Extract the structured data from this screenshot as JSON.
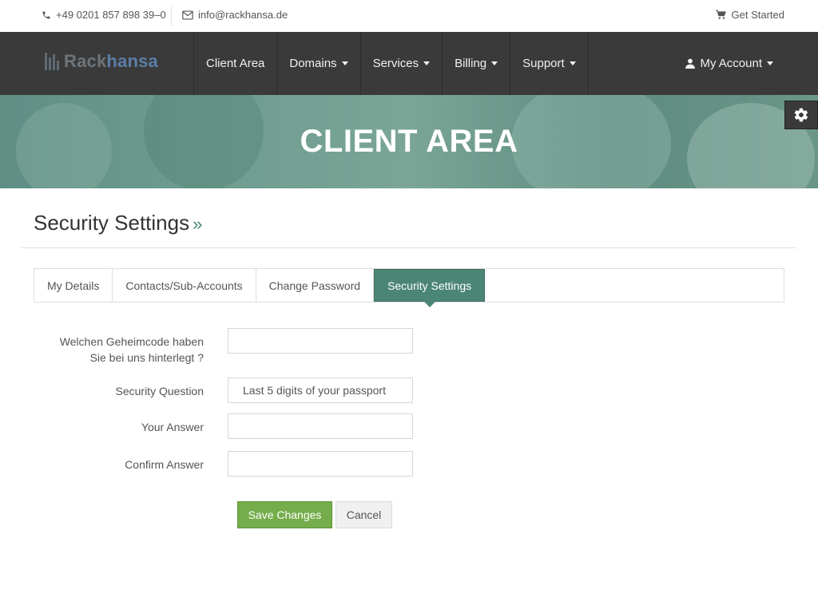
{
  "topbar": {
    "phone": "+49 0201 857 898 39–0",
    "email": "info@rackhansa.de",
    "cart_label": "Get Started",
    "phone_icon": "phone-icon",
    "email_icon": "envelope-icon",
    "cart_icon": "cart-icon"
  },
  "brand": {
    "part1": "Rack",
    "part2": "hansa"
  },
  "nav": {
    "items": [
      {
        "label": "Client Area"
      },
      {
        "label": "Domains"
      },
      {
        "label": "Services"
      },
      {
        "label": "Billing"
      },
      {
        "label": "Support"
      }
    ],
    "account_label": "My Account"
  },
  "banner": {
    "title": "CLIENT AREA"
  },
  "page": {
    "title": "Security Settings",
    "raquo": "»"
  },
  "tabs": [
    {
      "label": "My Details"
    },
    {
      "label": "Contacts/Sub-Accounts"
    },
    {
      "label": "Change Password"
    },
    {
      "label": "Security Settings"
    }
  ],
  "form": {
    "secret_code": {
      "label_line1": "Welchen Geheimcode haben",
      "label_line2": "Sie bei uns hinterlegt ?",
      "value": ""
    },
    "security_question": {
      "label": "Security Question",
      "value": "Last 5 digits of your passport"
    },
    "your_answer": {
      "label": "Your Answer",
      "value": ""
    },
    "confirm_answer": {
      "label": "Confirm Answer",
      "value": ""
    }
  },
  "buttons": {
    "save": "Save Changes",
    "cancel": "Cancel"
  },
  "colors": {
    "accent": "#4b8576",
    "save": "#74ad4a",
    "nav_bg": "#3a3a3a",
    "brand_blue": "#5b7ea6"
  }
}
